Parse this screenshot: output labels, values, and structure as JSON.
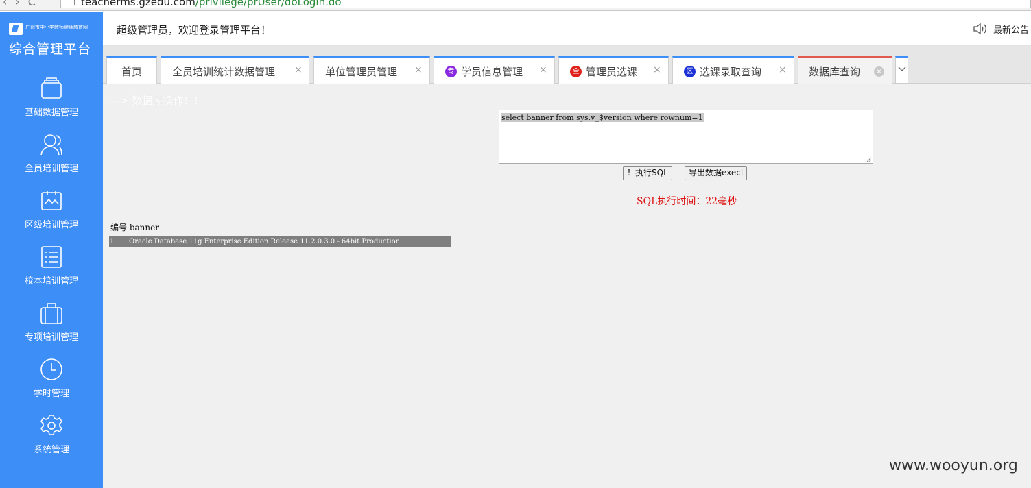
{
  "browser": {
    "url_host": "teacherms.gzedu.com",
    "url_path": "/privilege/prUser/doLogin.do"
  },
  "sidebar": {
    "logo_cn": "广州市中小学教师继续教育网",
    "logo_title": "综合管理平台",
    "items": [
      {
        "label": "基础数据管理",
        "icon": "folder-icon"
      },
      {
        "label": "全员培训管理",
        "icon": "users-icon"
      },
      {
        "label": "区级培训管理",
        "icon": "chart-icon"
      },
      {
        "label": "校本培训管理",
        "icon": "list-icon"
      },
      {
        "label": "专项培训管理",
        "icon": "bag-icon"
      },
      {
        "label": "学时管理",
        "icon": "clock-icon"
      },
      {
        "label": "系统管理",
        "icon": "gear-icon"
      }
    ]
  },
  "header": {
    "welcome": "超级管理员，欢迎登录管理平台！",
    "notice": "最新公告"
  },
  "tabs": [
    {
      "label": "首页",
      "badge": "",
      "badge_color": ""
    },
    {
      "label": "全员培训统计数据管理",
      "badge": "",
      "badge_color": ""
    },
    {
      "label": "单位管理员管理",
      "badge": "",
      "badge_color": ""
    },
    {
      "label": "学员信息管理",
      "badge": "专",
      "badge_color": "#8a2be2"
    },
    {
      "label": "管理员选课",
      "badge": "全",
      "badge_color": "#e0201a"
    },
    {
      "label": "选课录取查询",
      "badge": "区",
      "badge_color": "#1a2fd6"
    },
    {
      "label": "数据库查询",
      "badge": "",
      "badge_color": ""
    }
  ],
  "content": {
    "section_title": "—> 数据库操作！！",
    "sql_text": "select banner from sys.v_$version where rownum=1",
    "execute_label": "！执行SQL",
    "export_label": "导出数据execl",
    "exec_time": "SQL执行时间：22毫秒",
    "result_header": "编号 banner",
    "result_rows": [
      {
        "id": "1",
        "banner": "Oracle Database 11g Enterprise Edition Release 11.2.0.3.0 - 64bit Production"
      }
    ]
  },
  "watermark": "www.wooyun.org",
  "colors": {
    "sidebar": "#3e8ef7",
    "active_tab_border": "#e05a4e",
    "tab_border": "#3e8ef7",
    "exec_time": "#dd1111"
  }
}
